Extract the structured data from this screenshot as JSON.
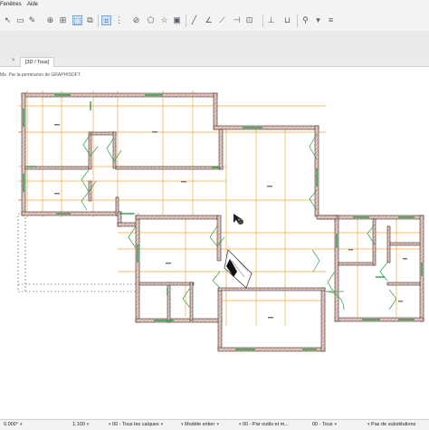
{
  "menu": {
    "items": [
      "Fenêtres",
      "Aide"
    ]
  },
  "tab": {
    "close_glyph": "×",
    "label": "[3D / Tous]"
  },
  "credit": "Mx. Par la permission de GRAPHISOFT.",
  "status": {
    "angle": "0.000°",
    "scale": "1:100",
    "layers": "00 - Tous les calques",
    "model": "Modèle entier",
    "view": "00 - Par outils et m...",
    "renovation": "00 - Tous",
    "substitution": "Pas de substitutions"
  },
  "colors": {
    "wall_fill": "#e8c8c0",
    "wall_stroke": "#333333",
    "window": "#2e9e44",
    "grid": "#f2a640",
    "axis": "#e85a5a",
    "accent": "#7aa6d6"
  },
  "icons": [
    "arrow-select-icon",
    "rectangle-icon",
    "zoom-icon",
    "marquee-icon",
    "snap-icon",
    "line-icon",
    "star-icon",
    "fill-icon",
    "pen-icon",
    "layers-icon"
  ]
}
